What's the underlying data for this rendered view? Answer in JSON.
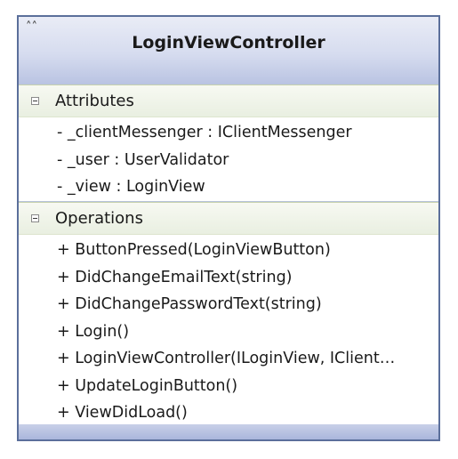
{
  "class": {
    "name": "LoginViewController",
    "collapse_glyph": "˄˄",
    "attributes": {
      "label": "Attributes",
      "items": [
        "- _clientMessenger : IClientMessenger",
        "- _user : UserValidator",
        "- _view : LoginView"
      ]
    },
    "operations": {
      "label": "Operations",
      "items": [
        "+ ButtonPressed(LoginViewButton)",
        "+ DidChangeEmailText(string)",
        "+ DidChangePasswordText(string)",
        "+ Login()",
        "+  LoginViewController(ILoginView,  IClient…",
        "+ UpdateLoginButton()",
        "+ ViewDidLoad()"
      ]
    }
  },
  "colors": {
    "border": "#5b6f9b",
    "header_gradient_top": "#e9ecf6",
    "header_gradient_bottom": "#b9c3e2",
    "compartment_header": "#e9efe1",
    "footer": "#aab6dc"
  }
}
